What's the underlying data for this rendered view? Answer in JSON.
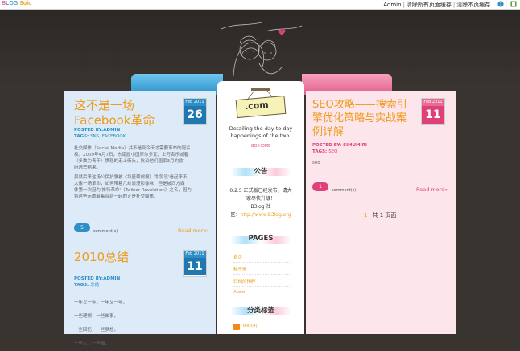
{
  "topbar": {
    "brand_b": "B",
    "brand_log": "LOG",
    "brand_solo": "Solo",
    "links": [
      "Admin",
      "清除所有页面缓存",
      "清除本页缓存"
    ]
  },
  "header": {
    "band_left_color": "#2b8fc9",
    "band_right_color": "#e25e8a"
  },
  "posts_left": [
    {
      "title_line1": "这不是一场",
      "title_line2": "Facebook革命",
      "month": "Feb 2011",
      "day": "26",
      "posted_by": "POSTED BY:ADMIN",
      "tags_label": "TAGS:",
      "tags": "SNS, FACEBOOK",
      "para1_line1": "社交媒体（Social Media）并不是到今天才需要革命的冠名",
      "para1_line2": "权。2009年4月7日，东南欧小国摩尔多瓦，上万名示威者",
      "para1_line3": "（多数为青年）愤怒的走上街头，抗议他们国家3月的欧",
      "para1_line4": "府选举结果。",
      "para2_line1": "虽然后来这场公民抗争被《华盛顿邮报》戏称'没'看起来不",
      "para2_line2": "太像一场革命，如何带着几丝浪漫影像味，但是被西方媒",
      "para2_line3": "体第一次冠为'推特革命'（Twitter Revolution）之名，因为",
      "para2_line4": "将这些示威者集合到一起的正是社交媒体。",
      "comments": "5",
      "comments_label": "comment(s)",
      "read_more": "Read more»"
    },
    {
      "title": "2010总结",
      "month": "Feb 2011",
      "day": "11",
      "posted_by": "POSTED BY:ADMIN",
      "tags_label": "TAGS:",
      "tags": "总结",
      "line1": "一年又一年，一年又一年，",
      "line2": "一些理想，一些故事，",
      "line3": "一些回忆，一些梦想，",
      "line4": "一些人，一些事，"
    }
  ],
  "middle": {
    "sign_text": ".com",
    "tagline_line1": "Detailing the day to day",
    "tagline_line2": "happenings of the two.",
    "go_home": "GO HOME",
    "notice_title": "公告",
    "notice_line1": "0.2.5 正式版已经发布，请大",
    "notice_line2": "家尽快升级！",
    "notice_line3": "B3log 社",
    "notice_line4_prefix": "区：",
    "notice_url": "http://www.b3log.org",
    "pages_title": "PAGES",
    "pages": [
      "首页",
      "标签墙",
      "归档的稀碎",
      "Atom"
    ],
    "tags_title": "分类标签",
    "tag_item": "Test(4)"
  },
  "posts_right": [
    {
      "title_line1": "SEO攻略——搜索引",
      "title_line2": "擎优化策略与实战案",
      "title_line3": "例详解",
      "month": "Feb 2011",
      "day": "11",
      "posted_by": "POSTED BY: SIMUMIRI",
      "tags_label": "TAGS:",
      "tags": "SEO",
      "excerpt": "seo",
      "comments": "1",
      "comments_label": "comment(s)",
      "read_more": "Read more»"
    }
  ],
  "pager": {
    "current": "1",
    "total_text": "共 1 页面"
  }
}
